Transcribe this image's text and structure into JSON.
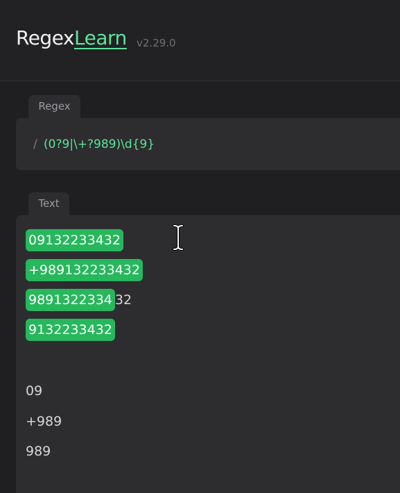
{
  "header": {
    "logo_part1": "Regex",
    "logo_part2": "Learn",
    "version": "v2.29.0"
  },
  "regex": {
    "tab_label": "Regex",
    "slash": "/",
    "pattern": "(0?9|\\+?989)\\d{9}"
  },
  "text": {
    "tab_label": "Text",
    "lines": [
      {
        "match": "09132233432",
        "rest": ""
      },
      {
        "match": "+989132233432",
        "rest": ""
      },
      {
        "match": "9891322334",
        "rest": "32"
      },
      {
        "match": "9132233432",
        "rest": ""
      },
      {
        "match": "",
        "rest": ""
      },
      {
        "match": "",
        "rest": "09"
      },
      {
        "match": "",
        "rest": "+989"
      },
      {
        "match": "",
        "rest": "989"
      }
    ]
  },
  "colors": {
    "accent": "#5fe39b",
    "match_bg": "#27b75d",
    "panel": "#2d2d30",
    "background": "#1f1f21"
  },
  "icons": {
    "cursor": "text-cursor-icon"
  }
}
